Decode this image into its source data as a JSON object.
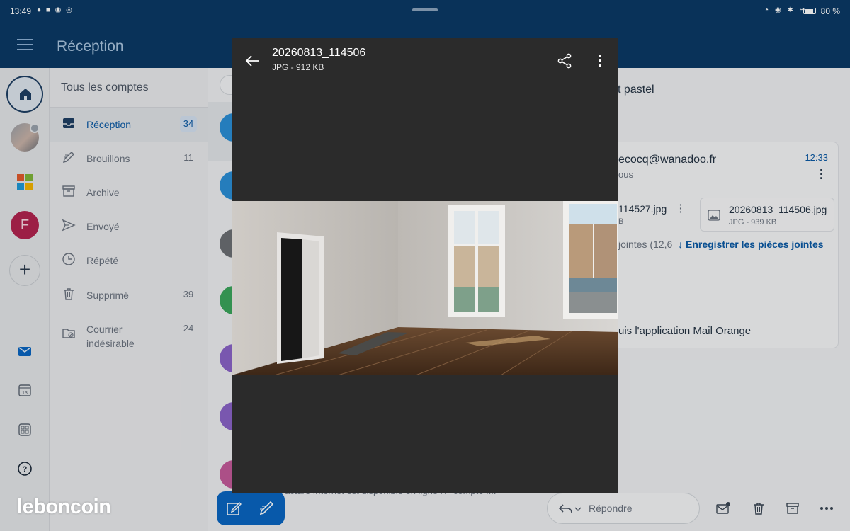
{
  "status_bar": {
    "time": "13:49",
    "battery": "80 %",
    "left_icons": [
      "notification-icon",
      "notification-icon",
      "notification-icon",
      "notification-icon"
    ],
    "right_icons": [
      "alarm-icon",
      "eye-icon",
      "bluetooth-icon",
      "wifi-icon",
      "battery-icon"
    ]
  },
  "app_bar": {
    "title": "Réception",
    "menu_icon": "hamburger-menu-icon"
  },
  "rail": {
    "items": [
      "home-icon",
      "account-avatar",
      "microsoft-icon",
      "account-f",
      "add-account-icon",
      "mail-icon",
      "calendar-icon",
      "apps-icon",
      "help-icon"
    ],
    "account_letter": "F",
    "calendar_day": "13"
  },
  "folders": {
    "header": "Tous les comptes",
    "items": [
      {
        "label": "Réception",
        "count": "34",
        "icon": "inbox-icon"
      },
      {
        "label": "Brouillons",
        "count": "11",
        "icon": "draft-icon"
      },
      {
        "label": "Archive",
        "count": "",
        "icon": "archive-icon"
      },
      {
        "label": "Envoyé",
        "count": "",
        "icon": "send-icon"
      },
      {
        "label": "Répété",
        "count": "",
        "icon": "clock-icon"
      },
      {
        "label": "Supprimé",
        "count": "39",
        "icon": "trash-icon"
      },
      {
        "label": "Courrier indésirable",
        "count": "24",
        "icon": "spam-folder-icon"
      }
    ]
  },
  "message_list": {
    "preview_snippet": "Facture Internet est disponible en ligne N° compte :..."
  },
  "reader": {
    "subject_fragment": "t pastel",
    "sender": "ecocq@wanadoo.fr",
    "recipient_fragment": "ous",
    "time": "12:33",
    "attachments": [
      {
        "name": "114527.jpg",
        "detail": "B"
      },
      {
        "name": "20260813_114506.jpg",
        "detail": "JPG - 939 KB"
      }
    ],
    "attachments_summary": "jointes (12,6",
    "save_attachments": "Enregistrer les pièces jointes",
    "signature_fragment": "uis l'application Mail Orange",
    "reply_label": "Répondre"
  },
  "viewer": {
    "title": "20260813_114506",
    "subtitle": "JPG - 912 KB",
    "actions": [
      "back-arrow-icon",
      "share-icon",
      "more-vert-icon"
    ]
  },
  "watermark": "leboncoin",
  "colors": {
    "app_bar": "#0b3a66",
    "accent": "#0a66c2",
    "viewer_bg": "#2b2b2b"
  }
}
